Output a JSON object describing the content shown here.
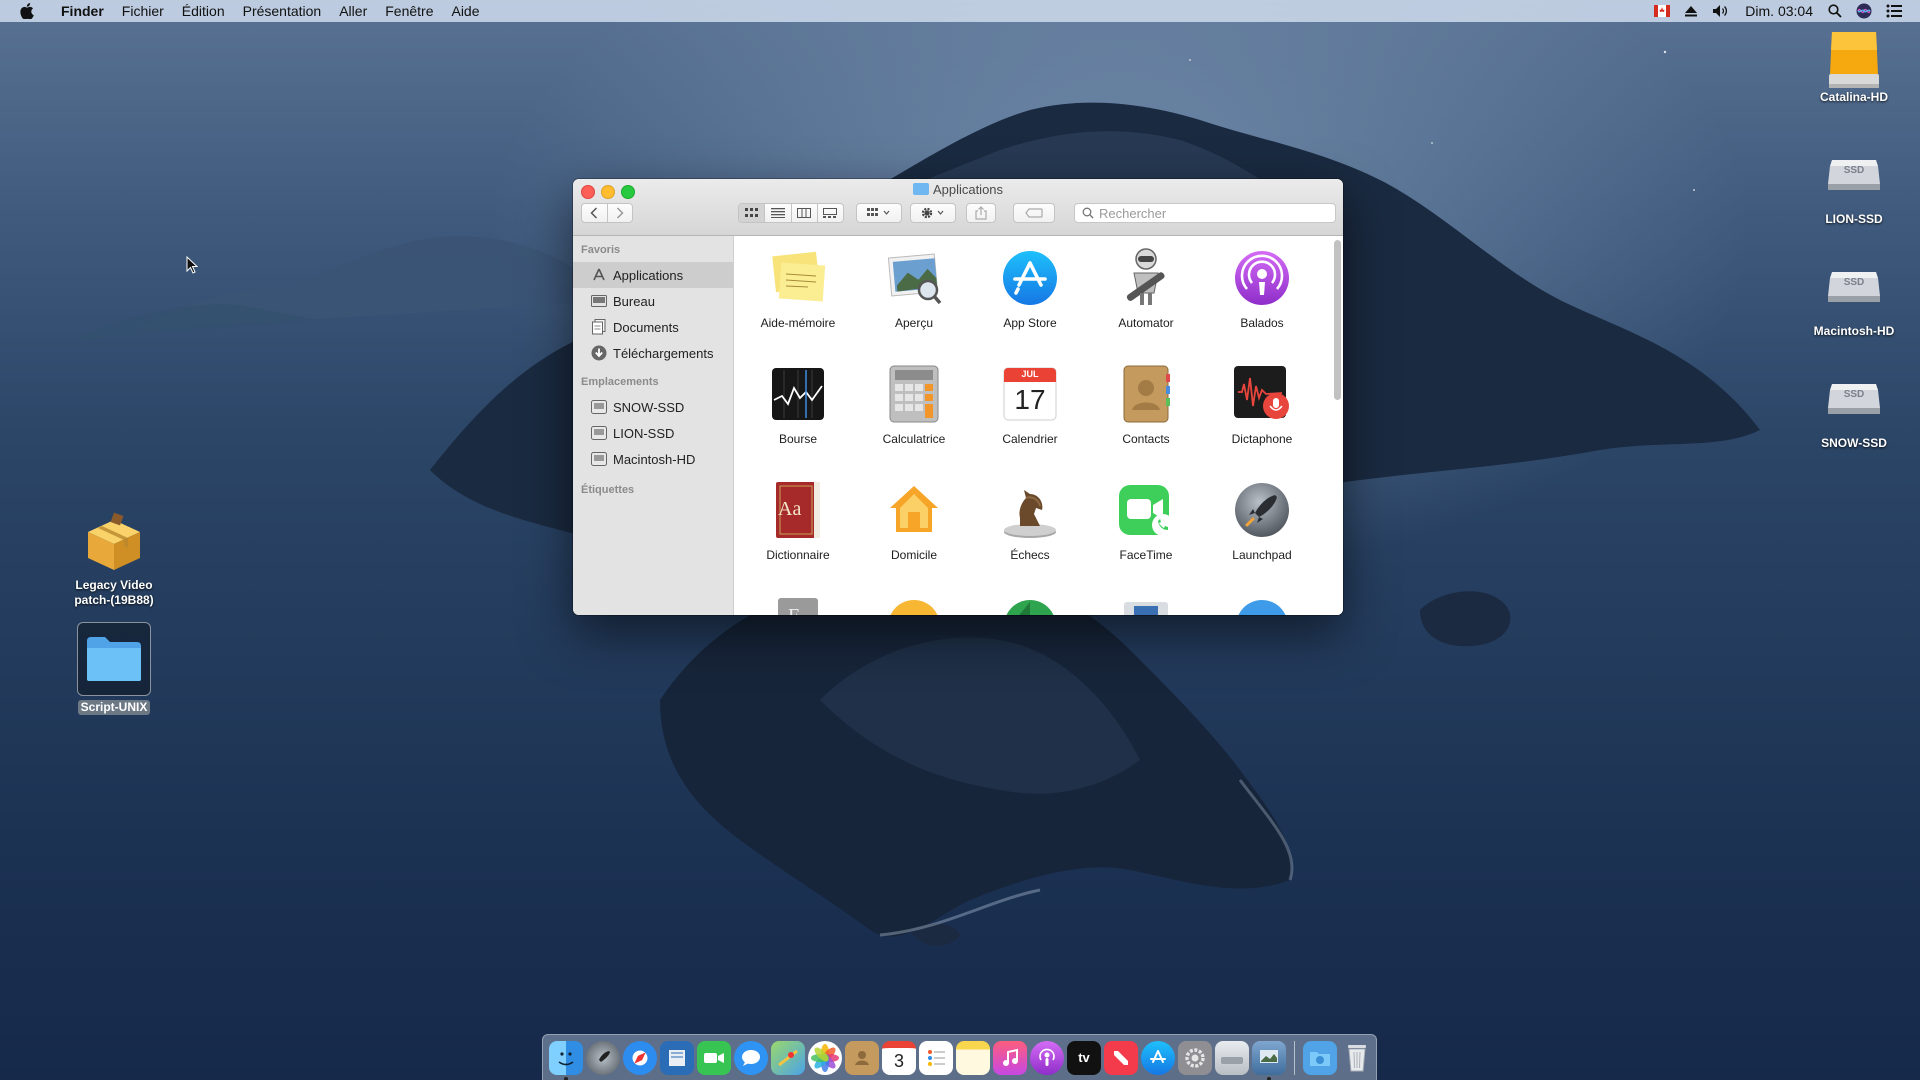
{
  "menubar": {
    "app_name": "Finder",
    "menus": [
      "Fichier",
      "Édition",
      "Présentation",
      "Aller",
      "Fenêtre",
      "Aide"
    ],
    "clock": "Dim. 03:04"
  },
  "desktop": {
    "drives": [
      {
        "label": "Catalina-HD"
      },
      {
        "label": "LION-SSD",
        "badge": "SSD"
      },
      {
        "label": "Macintosh-HD",
        "badge": "SSD"
      },
      {
        "label": "SNOW-SSD",
        "badge": "SSD"
      }
    ],
    "files": [
      {
        "label_line1": "Legacy Video",
        "label_line2": "patch-(19B88)"
      },
      {
        "label": "Script-UNIX"
      }
    ]
  },
  "window": {
    "title": "Applications",
    "search_placeholder": "Rechercher",
    "sidebar": {
      "favorites_header": "Favoris",
      "favorites": [
        {
          "label": "Applications",
          "icon": "applications-icon"
        },
        {
          "label": "Bureau",
          "icon": "desktop-icon"
        },
        {
          "label": "Documents",
          "icon": "documents-icon"
        },
        {
          "label": "Téléchargements",
          "icon": "downloads-icon"
        }
      ],
      "locations_header": "Emplacements",
      "locations": [
        {
          "label": "SNOW-SSD"
        },
        {
          "label": "LION-SSD"
        },
        {
          "label": "Macintosh-HD"
        }
      ],
      "tags_header": "Étiquettes"
    },
    "apps": [
      "Aide-mémoire",
      "Aperçu",
      "App Store",
      "Automator",
      "Balados",
      "Bourse",
      "Calculatrice",
      "Calendrier",
      "Contacts",
      "Dictaphone",
      "Dictionnaire",
      "Domicile",
      "Échecs",
      "FaceTime",
      "Launchpad"
    ],
    "calendar_icon": {
      "month": "JUL",
      "day": "17"
    },
    "dictionary_icon": {
      "text": "Aa"
    }
  },
  "dock": {
    "calendar": {
      "day": "3"
    },
    "tv_label": "tv"
  },
  "colors": {
    "accent": "#1c7cf5",
    "folder": "#62b6f3"
  }
}
